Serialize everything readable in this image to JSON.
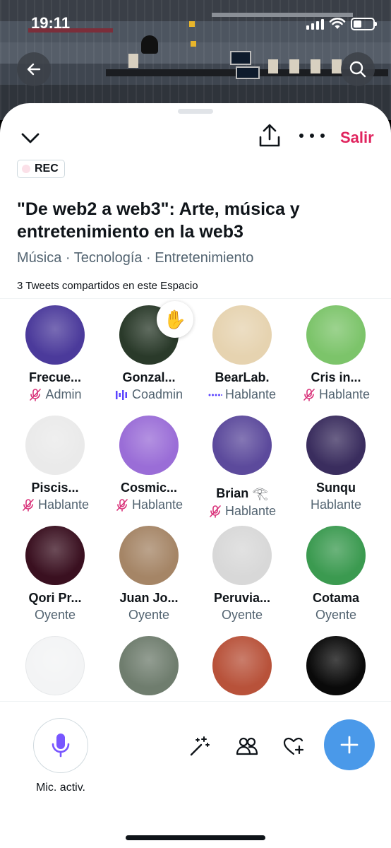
{
  "status_bar": {
    "time": "19:11"
  },
  "header": {
    "leave_label": "Salir",
    "rec_label": "REC",
    "title": "\"De web2 a web3\": Arte, música y entretenimiento en la web3",
    "topics": "Música · Tecnología · Entretenimiento",
    "shared_tweets": "3 Tweets compartidos en este Espacio"
  },
  "participants": [
    {
      "name": "Frecue...",
      "role": "Admin",
      "role_icon": "mic-muted-icon",
      "avatar_color": "#4b3a9b"
    },
    {
      "name": "Gonzal...",
      "role": "Coadmin",
      "role_icon": "speaking-bars-icon",
      "avatar_color": "#2a3a2a",
      "hand_raised": true,
      "hand_icon": "✋"
    },
    {
      "name": "BearLab.",
      "role": "Hablante",
      "role_icon": "speaking-dots-icon",
      "avatar_color": "#e6d3b0"
    },
    {
      "name": "Cris in...",
      "role": "Hablante",
      "role_icon": "mic-muted-icon",
      "avatar_color": "#7cc46a"
    },
    {
      "name": "Piscis...",
      "role": "Hablante",
      "role_icon": "mic-muted-icon",
      "avatar_color": "#eaeaea"
    },
    {
      "name": "Cosmic...",
      "role": "Hablante",
      "role_icon": "mic-muted-icon",
      "avatar_color": "#9a6dd7"
    },
    {
      "name": "Brian",
      "name_suffix": "𓂀",
      "role": "Hablante",
      "role_icon": "mic-muted-icon",
      "avatar_color": "#5c4a9c"
    },
    {
      "name": "Sunqu",
      "role": "Hablante",
      "role_icon": "none",
      "avatar_color": "#3a2d5e"
    },
    {
      "name": "Qori Pr...",
      "role": "Oyente",
      "role_icon": "none",
      "avatar_color": "#3a1020"
    },
    {
      "name": "Juan Jo...",
      "role": "Oyente",
      "role_icon": "none",
      "avatar_color": "#a58566"
    },
    {
      "name": "Peruvia...",
      "role": "Oyente",
      "role_icon": "none",
      "avatar_color": "#d8d8d8"
    },
    {
      "name": "Cotama",
      "role": "Oyente",
      "role_icon": "none",
      "avatar_color": "#3b9a50"
    },
    {
      "name": "",
      "role": "",
      "role_icon": "none",
      "avatar_color": "#f3f4f5"
    },
    {
      "name": "",
      "role": "",
      "role_icon": "none",
      "avatar_color": "#6f7d6e"
    },
    {
      "name": "",
      "role": "",
      "role_icon": "none",
      "avatar_color": "#b8523a"
    },
    {
      "name": "",
      "role": "",
      "role_icon": "none",
      "avatar_color": "#0a0a0a"
    }
  ],
  "bottom_bar": {
    "mic_label": "Mic. activ."
  },
  "colors": {
    "accent_red": "#e0245e",
    "fab_blue": "#4a99e9",
    "mic_purple": "#7856ff",
    "muted_pink": "#d9327a",
    "speaking_blue": "#5b44ff"
  }
}
